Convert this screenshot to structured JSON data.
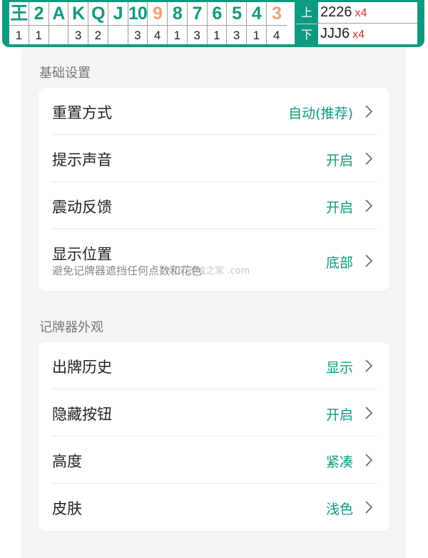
{
  "counter": {
    "cards": [
      {
        "rank": "王",
        "count": "1",
        "highlight": false
      },
      {
        "rank": "2",
        "count": "1",
        "highlight": false
      },
      {
        "rank": "A",
        "count": "",
        "highlight": false
      },
      {
        "rank": "K",
        "count": "3",
        "highlight": false
      },
      {
        "rank": "Q",
        "count": "2",
        "highlight": false
      },
      {
        "rank": "J",
        "count": "",
        "highlight": false
      },
      {
        "rank": "10",
        "count": "3",
        "highlight": false
      },
      {
        "rank": "9",
        "count": "4",
        "highlight": true
      },
      {
        "rank": "8",
        "count": "1",
        "highlight": false
      },
      {
        "rank": "7",
        "count": "3",
        "highlight": false
      },
      {
        "rank": "6",
        "count": "1",
        "highlight": false
      },
      {
        "rank": "5",
        "count": "3",
        "highlight": false
      },
      {
        "rank": "4",
        "count": "1",
        "highlight": false
      },
      {
        "rank": "3",
        "count": "4",
        "highlight": true
      }
    ],
    "up_label": "上",
    "down_label": "下",
    "history": [
      {
        "hand": "2226",
        "mult": "x4"
      },
      {
        "hand": "JJJ6",
        "mult": "x4"
      }
    ]
  },
  "sections": {
    "basic": {
      "title": "基础设置",
      "rows": [
        {
          "label": "重置方式",
          "value": "自动(推荐)"
        },
        {
          "label": "提示声音",
          "value": "开启"
        },
        {
          "label": "震动反馈",
          "value": "开启"
        },
        {
          "label": "显示位置",
          "sub": "避免记牌器遮挡任何点数和花色",
          "value": "底部"
        }
      ]
    },
    "appearance": {
      "title": "记牌器外观",
      "rows": [
        {
          "label": "出牌历史",
          "value": "显示"
        },
        {
          "label": "隐藏按钮",
          "value": "开启"
        },
        {
          "label": "高度",
          "value": "紧凑"
        },
        {
          "label": "皮肤",
          "value": "浅色"
        }
      ]
    }
  },
  "watermark": "K73 游戏之家 .com",
  "colors": {
    "accent": "#0e9a80",
    "highlight": "#f4a07c",
    "multiplier": "#d32f2f"
  }
}
